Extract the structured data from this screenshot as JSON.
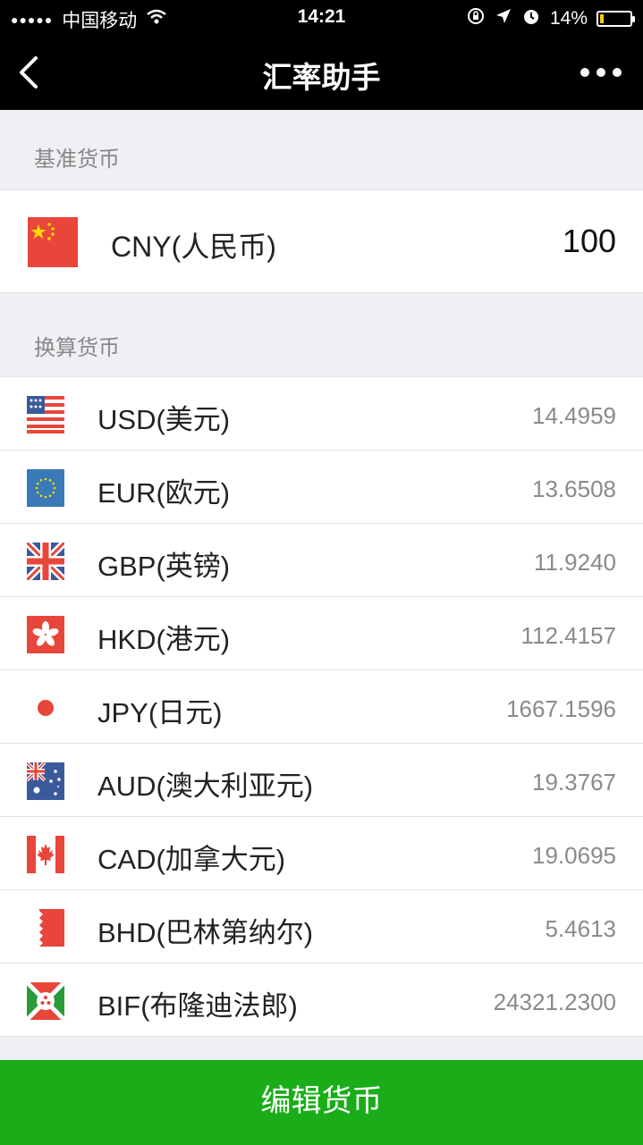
{
  "status": {
    "carrier": "中国移动",
    "time": "14:21",
    "battery": "14%",
    "battery_level": 0.14
  },
  "nav": {
    "title": "汇率助手"
  },
  "base_section": {
    "label": "基准货币",
    "currency": "CNY(人民币)",
    "amount": "100",
    "flag_icon": "china-flag-icon"
  },
  "convert_section": {
    "label": "换算货币",
    "items": [
      {
        "code": "USD(美元)",
        "rate": "14.4959",
        "flag_icon": "usa-flag-icon"
      },
      {
        "code": "EUR(欧元)",
        "rate": "13.6508",
        "flag_icon": "eu-flag-icon"
      },
      {
        "code": "GBP(英镑)",
        "rate": "11.9240",
        "flag_icon": "uk-flag-icon"
      },
      {
        "code": "HKD(港元)",
        "rate": "112.4157",
        "flag_icon": "hong-kong-flag-icon"
      },
      {
        "code": "JPY(日元)",
        "rate": "1667.1596",
        "flag_icon": "japan-flag-icon"
      },
      {
        "code": "AUD(澳大利亚元)",
        "rate": "19.3767",
        "flag_icon": "australia-flag-icon"
      },
      {
        "code": "CAD(加拿大元)",
        "rate": "19.0695",
        "flag_icon": "canada-flag-icon"
      },
      {
        "code": "BHD(巴林第纳尔)",
        "rate": "5.4613",
        "flag_icon": "bahrain-flag-icon"
      },
      {
        "code": "BIF(布隆迪法郎)",
        "rate": "24321.2300",
        "flag_icon": "burundi-flag-icon"
      }
    ]
  },
  "footer": {
    "edit_label": "编辑货币"
  },
  "colors": {
    "accent_green": "#1aad19",
    "nav_background": "#000000",
    "page_background": "#efeff4"
  }
}
